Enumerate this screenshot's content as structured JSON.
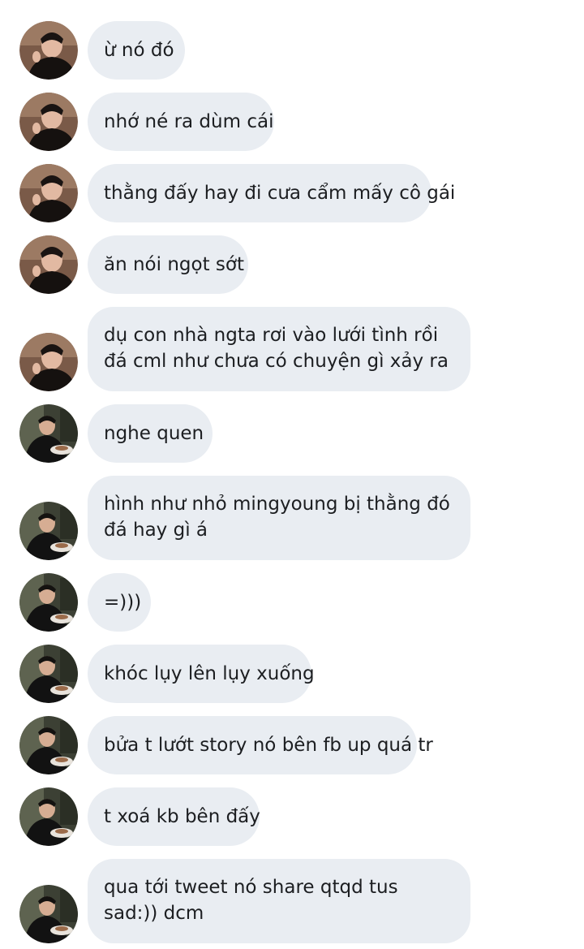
{
  "messages": [
    {
      "text": "ừ nó đó",
      "sender": "a"
    },
    {
      "text": "nhớ né ra dùm cái",
      "sender": "a"
    },
    {
      "text": "thằng đấy hay đi cưa cẩm mấy cô gái",
      "sender": "a"
    },
    {
      "text": "ăn nói ngọt sớt",
      "sender": "a"
    },
    {
      "text": "dụ con nhà ngta rơi vào lưới tình rồi đá cml như chưa có chuyện gì xảy ra",
      "sender": "a"
    },
    {
      "text": "nghe quen",
      "sender": "b"
    },
    {
      "text": "hình như nhỏ mingyoung bị thằng đó đá hay gì á",
      "sender": "b"
    },
    {
      "text": "=)))",
      "sender": "b"
    },
    {
      "text": "khóc lụy lên lụy xuống",
      "sender": "b"
    },
    {
      "text": "bửa t lướt story nó bên fb up quá tr",
      "sender": "b"
    },
    {
      "text": "t xoá kb bên đấy",
      "sender": "b"
    },
    {
      "text": "qua tới tweet nó share qtqd tus sad:)) dcm",
      "sender": "b"
    }
  ],
  "colors": {
    "bubble": "#e9edf2",
    "text": "#1c1e21",
    "background": "#ffffff"
  },
  "icons": {
    "sender_a_avatar": "avatar-photo-icon",
    "sender_b_avatar": "avatar-photo-icon"
  }
}
